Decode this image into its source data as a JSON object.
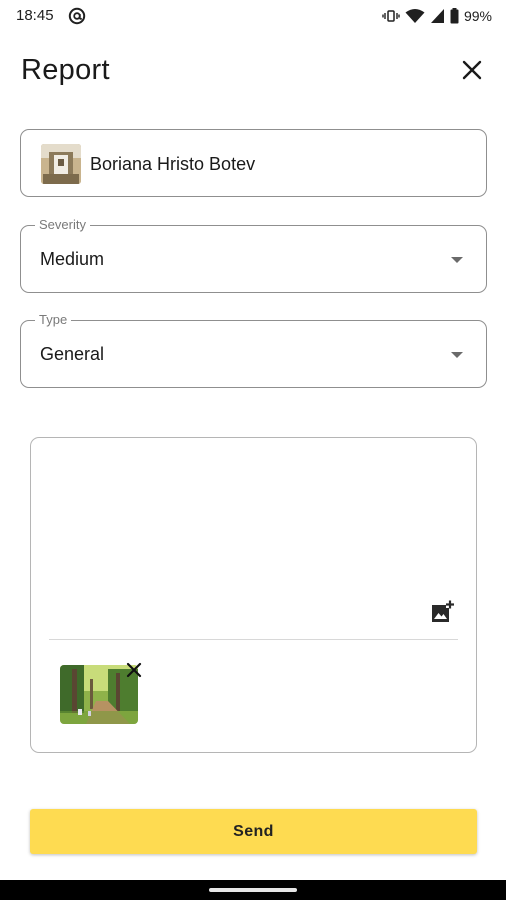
{
  "status_bar": {
    "time": "18:45",
    "battery_percent": "99%",
    "icons": [
      "at-sign-icon",
      "vibrate-icon",
      "wifi-icon",
      "signal-icon",
      "battery-icon"
    ]
  },
  "header": {
    "title": "Report",
    "close_icon": "close-icon"
  },
  "user_field": {
    "name": "Boriana Hristo Botev",
    "avatar_icon": "avatar"
  },
  "severity": {
    "label": "Severity",
    "value": "Medium"
  },
  "type": {
    "label": "Type",
    "value": "General"
  },
  "description": {
    "value": "",
    "add_image_icon": "add-photo-icon",
    "attachments": [
      {
        "kind": "image-thumbnail",
        "remove_icon": "close-icon"
      }
    ]
  },
  "send_button": {
    "label": "Send"
  },
  "colors": {
    "send_button_bg": "#fedb51",
    "field_border": "#8f8f8f",
    "nav_bar": "#000000"
  }
}
